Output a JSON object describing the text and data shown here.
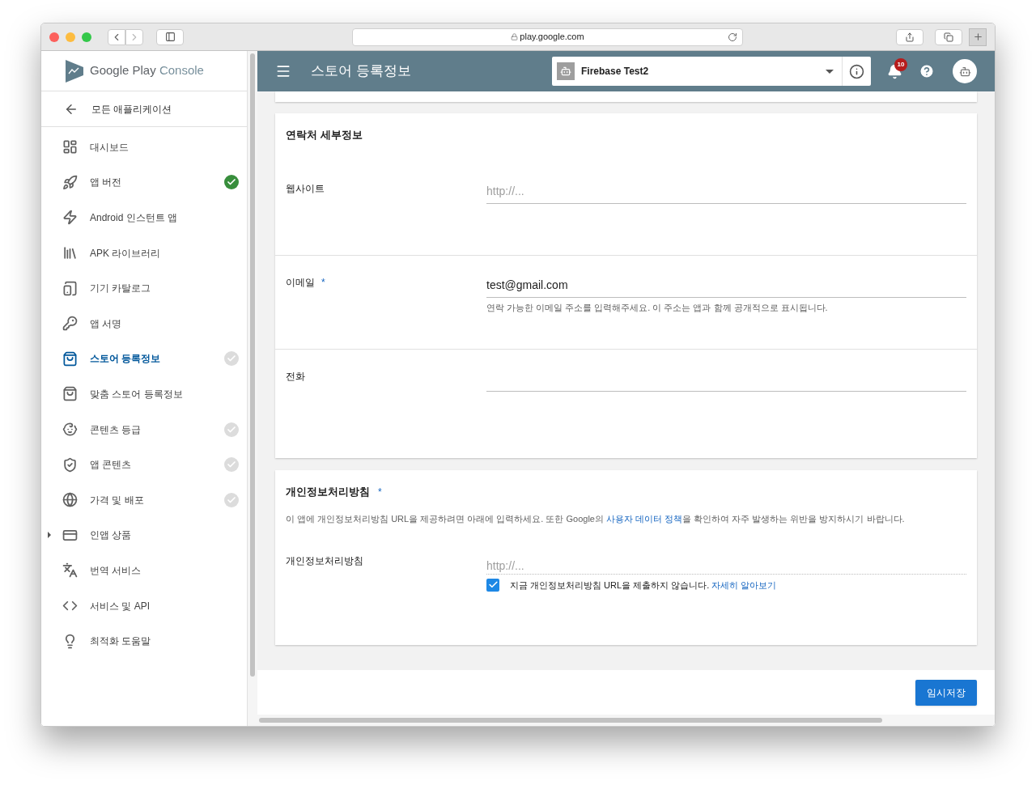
{
  "browser": {
    "url": "play.google.com"
  },
  "sidebar": {
    "brand": {
      "name": "Google Play",
      "product": "Console"
    },
    "back_link": "모든 애플리케이션",
    "items": [
      {
        "label": "대시보드",
        "selected": false,
        "checkmark": false,
        "expandable": false
      },
      {
        "label": "앱 버전",
        "selected": false,
        "checkmark": true,
        "complete": true,
        "expandable": false
      },
      {
        "label": "Android 인스턴트 앱",
        "selected": false,
        "checkmark": false,
        "expandable": false
      },
      {
        "label": "APK 라이브러리",
        "selected": false,
        "checkmark": false,
        "expandable": false
      },
      {
        "label": "기기 카탈로그",
        "selected": false,
        "checkmark": false,
        "expandable": false
      },
      {
        "label": "앱 서명",
        "selected": false,
        "checkmark": false,
        "expandable": false
      },
      {
        "label": "스토어 등록정보",
        "selected": true,
        "checkmark": true,
        "complete": false,
        "expandable": false
      },
      {
        "label": "맞춤 스토어 등록정보",
        "selected": false,
        "checkmark": false,
        "expandable": false
      },
      {
        "label": "콘텐츠 등급",
        "selected": false,
        "checkmark": true,
        "complete": false,
        "expandable": false
      },
      {
        "label": "앱 콘텐츠",
        "selected": false,
        "checkmark": true,
        "complete": false,
        "expandable": false
      },
      {
        "label": "가격 및 배포",
        "selected": false,
        "checkmark": true,
        "complete": false,
        "expandable": false
      },
      {
        "label": "인앱 상품",
        "selected": false,
        "checkmark": false,
        "expandable": true
      },
      {
        "label": "번역 서비스",
        "selected": false,
        "checkmark": false,
        "expandable": false
      },
      {
        "label": "서비스 및 API",
        "selected": false,
        "checkmark": false,
        "expandable": false
      },
      {
        "label": "최적화 도움말",
        "selected": false,
        "checkmark": false,
        "expandable": false
      }
    ]
  },
  "header": {
    "title": "스토어 등록정보",
    "app_selector": {
      "value": "Firebase Test2"
    },
    "notification_count": "10"
  },
  "contact_section": {
    "title": "연락처 세부정보",
    "fields": [
      {
        "label": "웹사이트",
        "placeholder": "http://..."
      },
      {
        "label": "이메일",
        "required_mark": "*",
        "value": "test@gmail.com",
        "hint": "연락 가능한 이메일 주소를 입력해주세요. 이 주소는 앱과 함께 공개적으로 표시됩니다."
      },
      {
        "label": "전화"
      }
    ]
  },
  "privacy_section": {
    "title": "개인정보처리방침",
    "required_mark": "*",
    "description": {
      "before": "이 앱에 개인정보처리방침 URL을 제공하려면 아래에 입력하세요. 또한 Google의 ",
      "link": "사용자 데이터 정책",
      "after": "을 확인하여 자주 발생하는 위반을 방지하시기 바랍니다."
    },
    "field": {
      "label": "개인정보처리방침",
      "placeholder": "http://..."
    },
    "opt_out": {
      "checked": true,
      "label": "지금 개인정보처리방침 URL을 제출하지 않습니다.",
      "link": "자세히 알아보기"
    }
  },
  "footer": {
    "save_button": "임시저장"
  }
}
